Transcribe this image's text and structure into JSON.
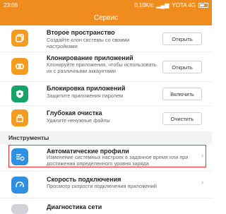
{
  "status": {
    "time": "23:06",
    "speed": "0,10K/c",
    "carrier": "YOTA 4G"
  },
  "header": {
    "title": "Сервис"
  },
  "services": [
    {
      "title": "Второе пространство",
      "desc": "Создайте клон системы со своими настройками",
      "button": "Открыть",
      "icon": "second-space-icon"
    },
    {
      "title": "Клонирование приложений",
      "desc": "Клонируйте приложения, чтобы использовать их с различными аккаунтами",
      "button": "Открыть",
      "icon": "clone-apps-icon"
    },
    {
      "title": "Блокировка приложений",
      "desc": "Защитите приложения паролем",
      "button": "Включить",
      "icon": "lock-icon"
    },
    {
      "title": "Глубокая очистка",
      "desc": "Удалите ненужные файлы",
      "button": "Очистить",
      "icon": "clean-icon"
    }
  ],
  "tools": {
    "title": "Инструменты",
    "items": [
      {
        "title": "Автоматические профили",
        "desc": "Изменение системных настроек в заданное время или при достижении определенного уровня заряда",
        "icon": "auto-profile-icon"
      },
      {
        "title": "Скорость подключения",
        "desc": "Просмотр скорости подключения приложений",
        "icon": "speed-icon"
      },
      {
        "title": "Диагностика сети",
        "desc": "",
        "icon": "network-icon"
      }
    ]
  },
  "colors": {
    "accent": "#f08c1e",
    "blue": "#2f8fe0",
    "green": "#18a36a",
    "highlight": "#ff2a2a"
  }
}
